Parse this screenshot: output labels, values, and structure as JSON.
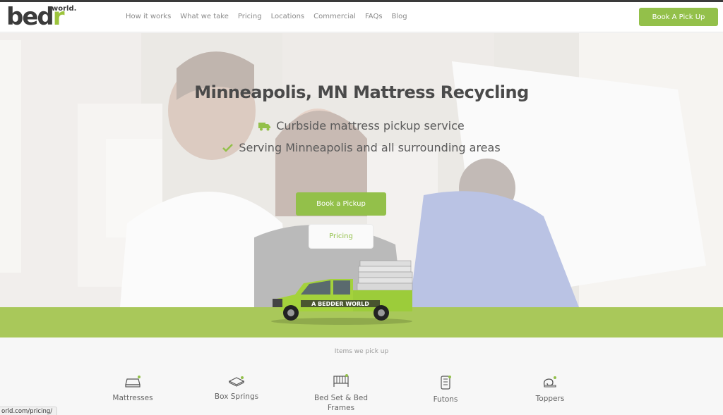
{
  "header": {
    "logo_main": "bedr",
    "logo_sub": "world.",
    "nav": [
      "How it works",
      "What we take",
      "Pricing",
      "Locations",
      "Commercial",
      "FAQs",
      "Blog"
    ],
    "cta": "Book A Pick Up"
  },
  "hero": {
    "title": "Minneapolis, MN Mattress Recycling",
    "line1": "Curbside mattress pickup service",
    "line2": "Serving Minneapolis and all surrounding areas",
    "book_button": "Book a Pickup",
    "pricing_button": "Pricing",
    "truck_text": "A BEDDER WORLD"
  },
  "items": {
    "title": "Items we pick up",
    "list": [
      {
        "label": "Mattresses",
        "icon": "mattress-icon"
      },
      {
        "label": "Box Springs",
        "icon": "box-spring-icon"
      },
      {
        "label": "Bed Set & Bed Frames",
        "icon": "bed-frame-icon"
      },
      {
        "label": "Futons",
        "icon": "futon-icon"
      },
      {
        "label": "Toppers",
        "icon": "topper-icon"
      }
    ]
  },
  "status_bar": {
    "url": "orld.com/pricing/"
  },
  "colors": {
    "accent": "#93c04a",
    "band": "#a9c85a",
    "text_dark": "#4a4a4a"
  }
}
